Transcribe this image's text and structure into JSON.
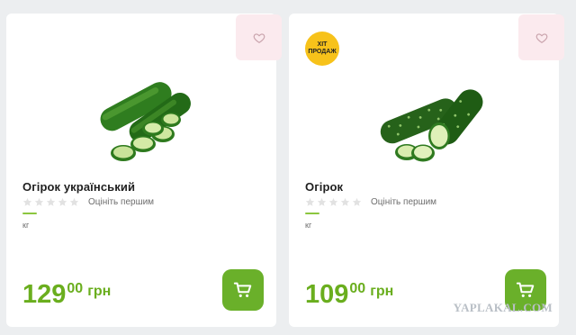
{
  "products": [
    {
      "title": "Огірок український",
      "rate_label": "Оцініть першим",
      "unit": "кг",
      "price_int": "129",
      "price_dec": "00",
      "currency": "грн",
      "rating_stars": 0,
      "badge": ""
    },
    {
      "title": "Огірок",
      "rate_label": "Оцініть першим",
      "unit": "кг",
      "price_int": "109",
      "price_dec": "00",
      "currency": "грн",
      "rating_stars": 0,
      "badge_line1": "ХІТ",
      "badge_line2": "ПРОДАЖ"
    }
  ],
  "watermark": "YAPLAKAL.COM",
  "colors": {
    "accent_green": "#6ab02a",
    "price_green": "#6aae1e",
    "favorite_bg": "#fbeaee",
    "badge_yellow": "#f7c21a"
  },
  "icons": {
    "favorite": "heart-outline-icon",
    "cart": "shopping-cart-icon",
    "star": "star-icon"
  }
}
